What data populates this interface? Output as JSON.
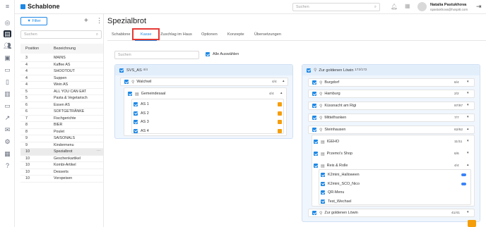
{
  "app": {
    "name": "Schablone",
    "search_placeholder": "Suchen",
    "user_name": "Natalia Pastukhova",
    "user_email": "npastukhova@hospitt.com"
  },
  "list": {
    "filter_label": "Filter",
    "search_placeholder": "Suchen",
    "col_position": "Position",
    "col_bezeichnung": "Bezeichnung",
    "rows": [
      [
        "3",
        "MAINS"
      ],
      [
        "4",
        "Kaffee AS"
      ],
      [
        "4",
        "SHOOTOUT"
      ],
      [
        "4",
        "Suppen"
      ],
      [
        "4",
        "Wein AS"
      ],
      [
        "5",
        "ALL YOU CAN EAT"
      ],
      [
        "5",
        "Pasta & Vegetarisch"
      ],
      [
        "6",
        "Essen AS"
      ],
      [
        "6",
        "SOFTGETRÄNKE"
      ],
      [
        "7",
        "Fischgerichte"
      ],
      [
        "8",
        "BIER"
      ],
      [
        "8",
        "Poulet"
      ],
      [
        "9",
        "SAISONALS"
      ],
      [
        "9",
        "Kindermenu"
      ],
      [
        "10",
        "Spezialbrot"
      ],
      [
        "10",
        "Geschenkartikel"
      ],
      [
        "10",
        "Kombi-Artikel"
      ],
      [
        "10",
        "Desserts"
      ],
      [
        "10",
        "Vorspeisen"
      ]
    ],
    "selected_index": 14
  },
  "page": {
    "title": "Spezialbrot",
    "tabs": [
      "Schablone",
      "Kasse",
      "Zuschlag im Haus",
      "Optionen",
      "Konzepte",
      "Übersetzungen"
    ],
    "active_tab": "Kasse",
    "search_placeholder": "Suchen",
    "select_all": "Alle Auswählen"
  },
  "left_card": {
    "title": "SVS_AS",
    "count": "4/4",
    "group": "Walchwil",
    "group_count": "4/4",
    "sub": "Gemeindesaal",
    "sub_count": "4/4",
    "items": [
      "AS 1",
      "AS 2",
      "AS 3",
      "AS 4"
    ]
  },
  "right_card": {
    "title": "Zur goldenen Löwin",
    "count": "172/172",
    "locations": [
      {
        "name": "Burgdorf",
        "count": "6/4"
      },
      {
        "name": "Hamburg",
        "count": "2/2"
      },
      {
        "name": "Küssnacht am Rigi",
        "count": "97/97"
      },
      {
        "name": "Mittelfranken",
        "count": "7/7"
      },
      {
        "name": "Steinhausen",
        "count": "62/62"
      }
    ],
    "steinhausen": [
      {
        "name": "IGEHO",
        "count": "11/11"
      },
      {
        "name": "Przemo's Shop",
        "count": "6/6"
      },
      {
        "name": "Reis & Rolle",
        "count": "4/4"
      }
    ],
    "reis": [
      "K2mini_Halloween",
      "K2mini_SCO_Nico",
      "QR-Menu",
      "Test_Wechsel"
    ],
    "last": {
      "name": "Zur goldenen Löwin",
      "count": "41/41"
    }
  },
  "colors": {
    "accent": "#1e88e5",
    "highlight": "#e53935",
    "orange": "#f59e0b"
  }
}
